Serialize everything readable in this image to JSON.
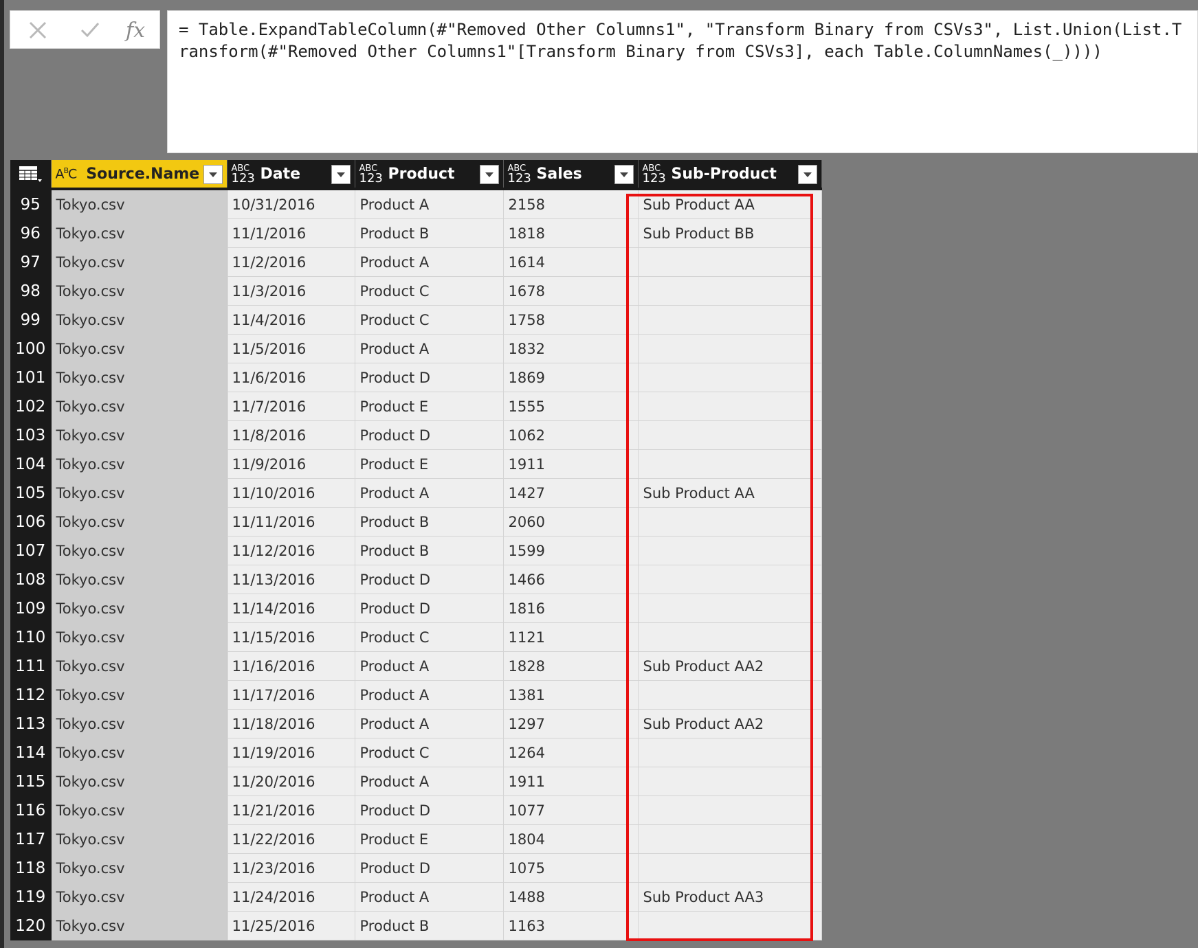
{
  "formula_bar": {
    "formula": "= Table.ExpandTableColumn(#\"Removed Other Columns1\", \"Transform Binary from CSVs3\", List.Union(List.Transform(#\"Removed Other Columns1\"[Transform Binary from CSVs3], each Table.ColumnNames(_))))",
    "cancel_icon": "close-x-icon",
    "commit_icon": "checkmark-icon",
    "insert_function_label": "fx"
  },
  "table": {
    "columns": [
      {
        "type": "ABC",
        "label": "Source.Name"
      },
      {
        "type_top": "ABC",
        "type_bottom": "123",
        "label": "Date"
      },
      {
        "type_top": "ABC",
        "type_bottom": "123",
        "label": "Product"
      },
      {
        "type_top": "ABC",
        "type_bottom": "123",
        "label": "Sales"
      },
      {
        "type_top": "ABC",
        "type_bottom": "123",
        "label": "Sub-Product"
      }
    ],
    "rows": [
      {
        "index": "95",
        "source": "Tokyo.csv",
        "date": "10/31/2016",
        "product": "Product A",
        "sales": "2158",
        "sub": "Sub Product AA"
      },
      {
        "index": "96",
        "source": "Tokyo.csv",
        "date": "11/1/2016",
        "product": "Product B",
        "sales": "1818",
        "sub": "Sub Product BB"
      },
      {
        "index": "97",
        "source": "Tokyo.csv",
        "date": "11/2/2016",
        "product": "Product A",
        "sales": "1614",
        "sub": ""
      },
      {
        "index": "98",
        "source": "Tokyo.csv",
        "date": "11/3/2016",
        "product": "Product C",
        "sales": "1678",
        "sub": ""
      },
      {
        "index": "99",
        "source": "Tokyo.csv",
        "date": "11/4/2016",
        "product": "Product C",
        "sales": "1758",
        "sub": ""
      },
      {
        "index": "100",
        "source": "Tokyo.csv",
        "date": "11/5/2016",
        "product": "Product A",
        "sales": "1832",
        "sub": ""
      },
      {
        "index": "101",
        "source": "Tokyo.csv",
        "date": "11/6/2016",
        "product": "Product D",
        "sales": "1869",
        "sub": ""
      },
      {
        "index": "102",
        "source": "Tokyo.csv",
        "date": "11/7/2016",
        "product": "Product E",
        "sales": "1555",
        "sub": ""
      },
      {
        "index": "103",
        "source": "Tokyo.csv",
        "date": "11/8/2016",
        "product": "Product D",
        "sales": "1062",
        "sub": ""
      },
      {
        "index": "104",
        "source": "Tokyo.csv",
        "date": "11/9/2016",
        "product": "Product E",
        "sales": "1911",
        "sub": ""
      },
      {
        "index": "105",
        "source": "Tokyo.csv",
        "date": "11/10/2016",
        "product": "Product A",
        "sales": "1427",
        "sub": "Sub Product AA"
      },
      {
        "index": "106",
        "source": "Tokyo.csv",
        "date": "11/11/2016",
        "product": "Product B",
        "sales": "2060",
        "sub": ""
      },
      {
        "index": "107",
        "source": "Tokyo.csv",
        "date": "11/12/2016",
        "product": "Product B",
        "sales": "1599",
        "sub": ""
      },
      {
        "index": "108",
        "source": "Tokyo.csv",
        "date": "11/13/2016",
        "product": "Product D",
        "sales": "1466",
        "sub": ""
      },
      {
        "index": "109",
        "source": "Tokyo.csv",
        "date": "11/14/2016",
        "product": "Product D",
        "sales": "1816",
        "sub": ""
      },
      {
        "index": "110",
        "source": "Tokyo.csv",
        "date": "11/15/2016",
        "product": "Product C",
        "sales": "1121",
        "sub": ""
      },
      {
        "index": "111",
        "source": "Tokyo.csv",
        "date": "11/16/2016",
        "product": "Product A",
        "sales": "1828",
        "sub": "Sub Product AA2"
      },
      {
        "index": "112",
        "source": "Tokyo.csv",
        "date": "11/17/2016",
        "product": "Product A",
        "sales": "1381",
        "sub": ""
      },
      {
        "index": "113",
        "source": "Tokyo.csv",
        "date": "11/18/2016",
        "product": "Product A",
        "sales": "1297",
        "sub": "Sub Product AA2"
      },
      {
        "index": "114",
        "source": "Tokyo.csv",
        "date": "11/19/2016",
        "product": "Product C",
        "sales": "1264",
        "sub": ""
      },
      {
        "index": "115",
        "source": "Tokyo.csv",
        "date": "11/20/2016",
        "product": "Product A",
        "sales": "1911",
        "sub": ""
      },
      {
        "index": "116",
        "source": "Tokyo.csv",
        "date": "11/21/2016",
        "product": "Product D",
        "sales": "1077",
        "sub": ""
      },
      {
        "index": "117",
        "source": "Tokyo.csv",
        "date": "11/22/2016",
        "product": "Product E",
        "sales": "1804",
        "sub": ""
      },
      {
        "index": "118",
        "source": "Tokyo.csv",
        "date": "11/23/2016",
        "product": "Product D",
        "sales": "1075",
        "sub": ""
      },
      {
        "index": "119",
        "source": "Tokyo.csv",
        "date": "11/24/2016",
        "product": "Product A",
        "sales": "1488",
        "sub": "Sub Product AA3"
      },
      {
        "index": "120",
        "source": "Tokyo.csv",
        "date": "11/25/2016",
        "product": "Product B",
        "sales": "1163",
        "sub": ""
      }
    ]
  },
  "colors": {
    "selected_header": "#f2c811",
    "header_bg": "#1a1a1a",
    "highlight_box": "#e81010"
  }
}
